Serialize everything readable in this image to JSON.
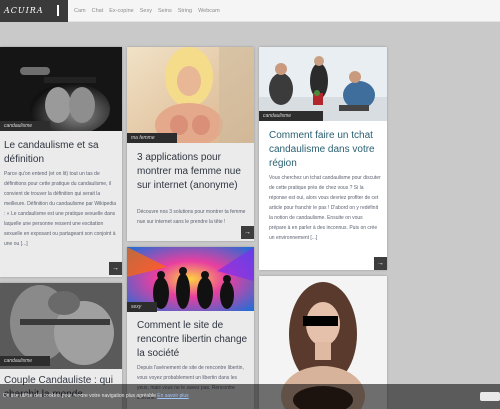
{
  "header": {
    "logo_text": "ACUIRA",
    "menu": [
      {
        "label": "Cam"
      },
      {
        "label": "Chat"
      },
      {
        "label": "Ex-copine"
      },
      {
        "label": "Sexy"
      },
      {
        "label": "Seins"
      },
      {
        "label": "String"
      },
      {
        "label": "Webcam"
      }
    ]
  },
  "cards": [
    {
      "tag": "candaulisme",
      "title": "Le candaulisme et sa définition",
      "excerpt": "Parce qu'on entend (et on lit) tout un tas de définitions pour cette pratique du candaulisme, il convient de trouver la définition qui serait la meilleure. Définition du candaulisme par Wikipedia : « Le candaulisme est une pratique sexuelle dans laquelle une personne ressent une excitation sexuelle en exposant ou partageant son conjoint à une ou [...]",
      "more": "→"
    },
    {
      "tag": "ma femme",
      "title": "3 applications pour montrer ma femme nue sur internet (anonyme)",
      "excerpt": "Découvre nos 3 solutions pour montrer ta femme nue sur internet sans le prendre la tête !",
      "more": "→"
    },
    {
      "tag": "candaulisme",
      "title": "Comment faire un tchat candaulisme dans votre région",
      "excerpt": "Vous cherchez un tchat candaulisme pour discuter de cette pratique près de chez vous ? Si la réponse est oui, alors vous devriez profiter de cet article pour franchir le pas ! D'abord on y redéfinit la notion de candaulisme. Ensuite on vous prépare à en parler à des inconnus. Puis on crée un environnement [...]",
      "more": "→"
    },
    {
      "tag": "candaulisme",
      "title": "Couple Candauliste : qui cherchit la monde"
    },
    {
      "tag": "sexy",
      "title": "Comment le site de rencontre libertin change la société",
      "excerpt": "Depuis l'avènement de site de rencontre libertin, vous voyez probablement un libertin dans les yeux, mais vous ne le savez pas. Rencontre libertine."
    },
    {
      "tag": ""
    }
  ],
  "cookie": {
    "message": "Ce site utilise des cookies pour rendre votre navigation plus agréable",
    "link": "En savoir plus"
  },
  "colors": {
    "page_bg": "#c9c9c9",
    "topbar_bg": "#f5f5f5",
    "logo_bg": "#3a3a3a",
    "title_color": "#2f3540",
    "tag_bg": "#2d2d2d"
  }
}
